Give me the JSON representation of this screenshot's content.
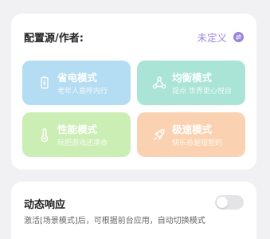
{
  "config": {
    "title": "配置源/作者:",
    "value": "未定义",
    "accent": "#9d85de",
    "icon": "swap-icon"
  },
  "modes": [
    {
      "name": "省电模式",
      "desc": "老年人直呼内行",
      "icon": "battery-icon",
      "color": "#b4dcf2"
    },
    {
      "name": "均衡模式",
      "desc": "提点 世界更心悦目",
      "icon": "molecule-icon",
      "color": "#a9e4d6"
    },
    {
      "name": "性能模式",
      "desc": "玩把游戏还凑合",
      "icon": "thermometer-icon",
      "color": "#cbeeb4"
    },
    {
      "name": "极速模式",
      "desc": "快乐总是短暂的",
      "icon": "rocket-icon",
      "color": "#fbd2b1"
    }
  ],
  "dynamic": {
    "title": "动态响应",
    "desc": "激活[场景模式]后，可根据前台应用，自动切换模式",
    "toggle_on": false
  }
}
